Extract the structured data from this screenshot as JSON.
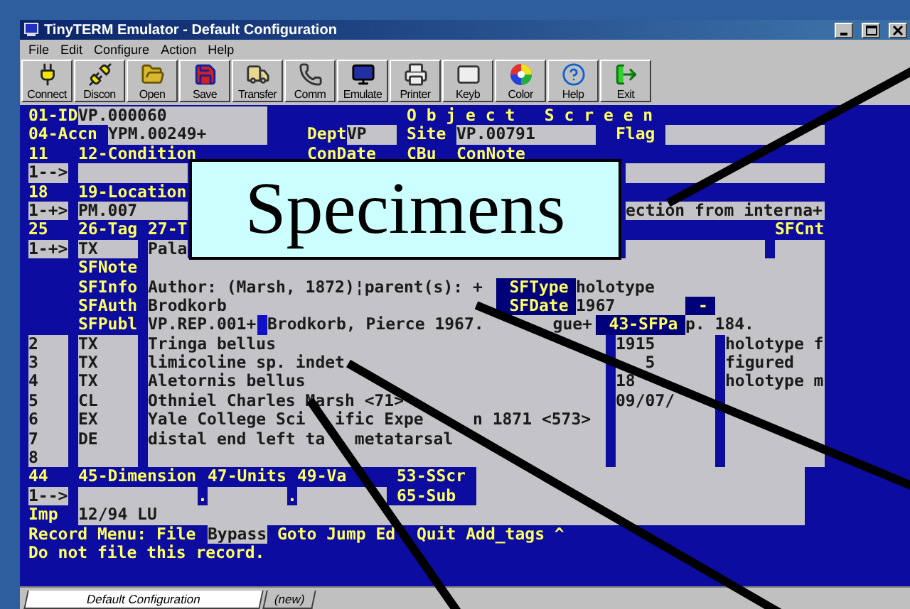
{
  "window": {
    "title": "TinyTERM Emulator - Default Configuration"
  },
  "menu": [
    "File",
    "Edit",
    "Configure",
    "Action",
    "Help"
  ],
  "toolbar": [
    "Connect",
    "Discon",
    "Open",
    "Save",
    "Transfer",
    "Comm",
    "Emulate",
    "Printer",
    "Keyb",
    "Color",
    "Help",
    "Exit"
  ],
  "terminal": {
    "rows": [
      {
        "segments": [
          {
            "kind": "label",
            "text": "01-ID"
          },
          {
            "kind": "field",
            "text": "VP.000060"
          },
          {
            "kind": "label",
            "text": "O b j e c t   S c r e e n"
          }
        ]
      },
      {
        "segments": [
          {
            "kind": "label",
            "text": "04-Accn"
          },
          {
            "kind": "field",
            "text": "YPM.00249+"
          },
          {
            "kind": "label",
            "text": "Dept"
          },
          {
            "kind": "field",
            "text": "VP"
          },
          {
            "kind": "label",
            "text": "Site"
          },
          {
            "kind": "field",
            "text": "VP.00791"
          },
          {
            "kind": "label",
            "text": "Flag"
          },
          {
            "kind": "field"
          }
        ]
      },
      {
        "segments": [
          {
            "kind": "label",
            "text": "11"
          },
          {
            "kind": "label",
            "text": "12-Condition"
          },
          {
            "kind": "label",
            "text": "ConDate"
          },
          {
            "kind": "label",
            "text": "CBu"
          },
          {
            "kind": "label",
            "text": "ConNote"
          }
        ]
      },
      {
        "segments": [
          {
            "kind": "field",
            "text": "1-->"
          },
          {
            "kind": "field"
          },
          {
            "kind": "field"
          }
        ]
      },
      {
        "segments": [
          {
            "kind": "label",
            "text": "18"
          },
          {
            "kind": "label",
            "text": "19-Location"
          }
        ]
      },
      {
        "segments": [
          {
            "kind": "field",
            "text": "1-+>"
          },
          {
            "kind": "field",
            "text": "PM.007"
          },
          {
            "kind": "field",
            "text": "ection from interna+"
          }
        ]
      },
      {
        "segments": [
          {
            "kind": "label",
            "text": "25"
          },
          {
            "kind": "label",
            "text": "26-Tag"
          },
          {
            "kind": "label",
            "text": "27-T"
          },
          {
            "kind": "label",
            "text": "SFCnt"
          }
        ]
      },
      {
        "segments": [
          {
            "kind": "field",
            "text": "1-+>"
          },
          {
            "kind": "field",
            "text": "TX"
          },
          {
            "kind": "field",
            "text": "Pala"
          },
          {
            "kind": "field"
          },
          {
            "kind": "field"
          }
        ]
      },
      {
        "segments": [
          {
            "kind": "label",
            "text": "SFNote"
          },
          {
            "kind": "field"
          }
        ]
      },
      {
        "segments": [
          {
            "kind": "label",
            "text": "SFInfo"
          },
          {
            "kind": "field",
            "text": "Author: (Marsh, 1872)¦parent(s): +"
          },
          {
            "kind": "tag",
            "text": "SFType"
          },
          {
            "kind": "field",
            "text": "holotype"
          }
        ]
      },
      {
        "segments": [
          {
            "kind": "label",
            "text": "SFAuth"
          },
          {
            "kind": "field",
            "text": "Brodkorb"
          },
          {
            "kind": "tag",
            "text": "SFDate"
          },
          {
            "kind": "field",
            "text": "1967"
          },
          {
            "kind": "tag",
            "text": "-"
          },
          {
            "kind": "field"
          }
        ]
      },
      {
        "segments": [
          {
            "kind": "label",
            "text": "SFPubl"
          },
          {
            "kind": "field",
            "text": "VP.REP.001+"
          },
          {
            "kind": "cursor"
          },
          {
            "kind": "field",
            "text": "Brodkorb, Pierce 1967.       gue+"
          },
          {
            "kind": "tag",
            "text": "43-SFPa"
          },
          {
            "kind": "field",
            "text": "p. 184."
          }
        ]
      },
      {
        "segments": [
          {
            "kind": "field",
            "text": "2"
          },
          {
            "kind": "field",
            "text": "TX"
          },
          {
            "kind": "field",
            "text": "Tringa bellus"
          },
          {
            "kind": "field",
            "text": "1915"
          },
          {
            "kind": "field",
            "text": "holotype f"
          }
        ]
      },
      {
        "segments": [
          {
            "kind": "field",
            "text": "3"
          },
          {
            "kind": "field",
            "text": "TX"
          },
          {
            "kind": "field",
            "text": "limicoline sp. indet"
          },
          {
            "kind": "field",
            "text": "   5"
          },
          {
            "kind": "field",
            "text": "figured"
          }
        ]
      },
      {
        "segments": [
          {
            "kind": "field",
            "text": "4"
          },
          {
            "kind": "field",
            "text": "TX"
          },
          {
            "kind": "field",
            "text": "Aletornis bellus"
          },
          {
            "kind": "field",
            "text": "18"
          },
          {
            "kind": "field",
            "text": "holotype m"
          }
        ]
      },
      {
        "segments": [
          {
            "kind": "field",
            "text": "5"
          },
          {
            "kind": "field",
            "text": "CL"
          },
          {
            "kind": "field",
            "text": "Othniel Charles Marsh <71>"
          },
          {
            "kind": "field",
            "text": "09/07/"
          },
          {
            "kind": "field"
          }
        ]
      },
      {
        "segments": [
          {
            "kind": "field",
            "text": "6"
          },
          {
            "kind": "field",
            "text": "EX"
          },
          {
            "kind": "field",
            "text": "Yale College Sci   ific Expe     n 1871 <573>"
          },
          {
            "kind": "field"
          },
          {
            "kind": "field"
          }
        ]
      },
      {
        "segments": [
          {
            "kind": "field",
            "text": "7"
          },
          {
            "kind": "field",
            "text": "DE"
          },
          {
            "kind": "field",
            "text": "distal end left ta   metatarsal"
          },
          {
            "kind": "field"
          },
          {
            "kind": "field"
          }
        ]
      },
      {
        "segments": [
          {
            "kind": "field",
            "text": "8"
          },
          {
            "kind": "field"
          },
          {
            "kind": "field"
          },
          {
            "kind": "field"
          },
          {
            "kind": "field"
          }
        ]
      },
      {
        "segments": [
          {
            "kind": "label",
            "text": "44"
          },
          {
            "kind": "label",
            "text": "45-Dimension"
          },
          {
            "kind": "label",
            "text": "47-Units"
          },
          {
            "kind": "label",
            "text": "49-Va"
          },
          {
            "kind": "label",
            "text": "53-SScr"
          },
          {
            "kind": "field"
          }
        ]
      },
      {
        "segments": [
          {
            "kind": "field",
            "text": "1-->"
          },
          {
            "kind": "field"
          },
          {
            "kind": "label",
            "text": "."
          },
          {
            "kind": "field"
          },
          {
            "kind": "label",
            "text": "."
          },
          {
            "kind": "field"
          },
          {
            "kind": "label",
            "text": "65-Sub"
          },
          {
            "kind": "field"
          }
        ]
      },
      {
        "segments": [
          {
            "kind": "label",
            "text": "Imp"
          },
          {
            "kind": "field",
            "text": "12/94 LU"
          }
        ]
      },
      {
        "segments": [
          {
            "kind": "label",
            "text": "Record Menu: File"
          },
          {
            "kind": "field",
            "text": "Bypass"
          },
          {
            "kind": "label",
            "text": "Goto Jump Ed"
          },
          {
            "kind": "label",
            "text": "Quit Add_tags ^"
          }
        ]
      },
      {
        "segments": [
          {
            "kind": "label",
            "text": "Do not file this record."
          }
        ]
      }
    ]
  },
  "callout": {
    "text": "Specimens"
  },
  "tabs": [
    {
      "label": "Default Configuration",
      "selected": true
    },
    {
      "label": "(new)",
      "selected": false
    }
  ]
}
